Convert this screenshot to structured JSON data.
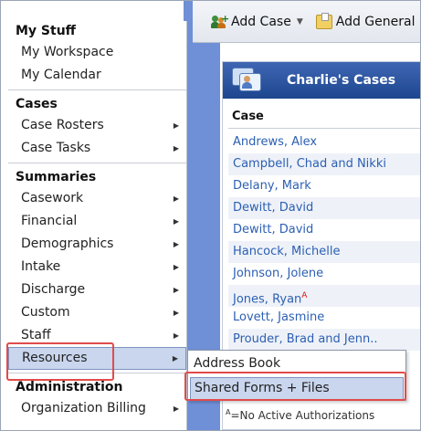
{
  "toolbar": {
    "add_case_label": "Add Case",
    "add_general_label": "Add General"
  },
  "panel": {
    "title": "Charlie's Cases",
    "column_header": "Case",
    "rows": [
      "Andrews, Alex",
      "Campbell, Chad and Nikki",
      "Delany, Mark",
      "Dewitt, David",
      "Dewitt, David",
      "Hancock, Michelle",
      "Johnson, Jolene",
      "Jones, Ryan",
      "Lovett, Jasmine",
      "Prouder, Brad and Jenn.."
    ],
    "row_badge": "A",
    "footnote_mark": "A",
    "footnote_text": "=No Active Authorizations"
  },
  "menu": {
    "sections": {
      "my_stuff": "My Stuff",
      "cases": "Cases",
      "summaries": "Summaries",
      "administration": "Administration"
    },
    "items": {
      "my_workspace": "My Workspace",
      "my_calendar": "My Calendar",
      "case_rosters": "Case Rosters",
      "case_tasks": "Case Tasks",
      "casework": "Casework",
      "financial": "Financial",
      "demographics": "Demographics",
      "intake": "Intake",
      "discharge": "Discharge",
      "custom": "Custom",
      "staff": "Staff",
      "resources": "Resources",
      "organization_billing": "Organization Billing"
    }
  },
  "submenu": {
    "address_book": "Address Book",
    "shared_forms": "Shared Forms + Files"
  },
  "colors": {
    "accent_blue": "#1d468f",
    "link_blue": "#2c5fb3",
    "highlight": "#c9d6ee",
    "annotation_red": "#e14b4b"
  }
}
